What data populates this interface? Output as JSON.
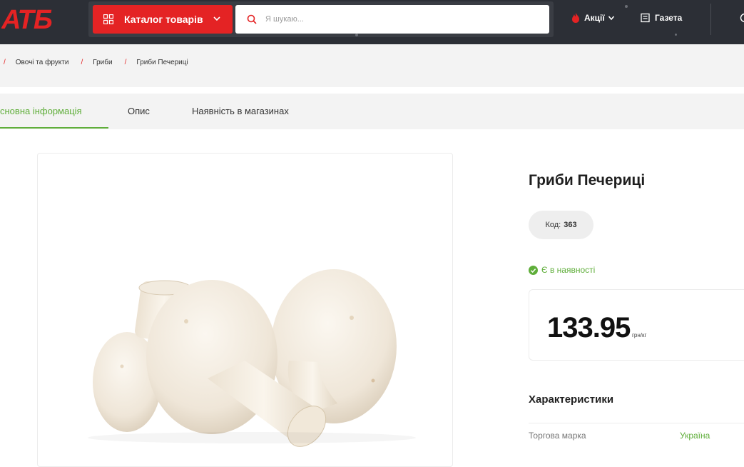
{
  "header": {
    "logo_text": "АТБ",
    "catalog_label": "Каталог товарів",
    "search_placeholder": "Я шукаю...",
    "promo_label": "Акції",
    "news_label": "Газета"
  },
  "breadcrumb": {
    "items": [
      "Овочі та фрукти",
      "Гриби",
      "Гриби Печериці"
    ]
  },
  "tabs": [
    "сновна інформація",
    "Опис",
    "Наявність в магазинах"
  ],
  "product": {
    "title": "Гриби Печериці",
    "code_label": "Код:",
    "code_value": "363",
    "stock_label": "Є в наявності",
    "price": "133.95",
    "unit": "грн/кг"
  },
  "characteristics": {
    "title": "Характеристики",
    "rows": [
      {
        "label": "Торгова марка",
        "value": "Україна"
      }
    ]
  },
  "colors": {
    "brand_red": "#e42324",
    "accent_green": "#5fae3a",
    "header_bg": "#2c2f36"
  }
}
